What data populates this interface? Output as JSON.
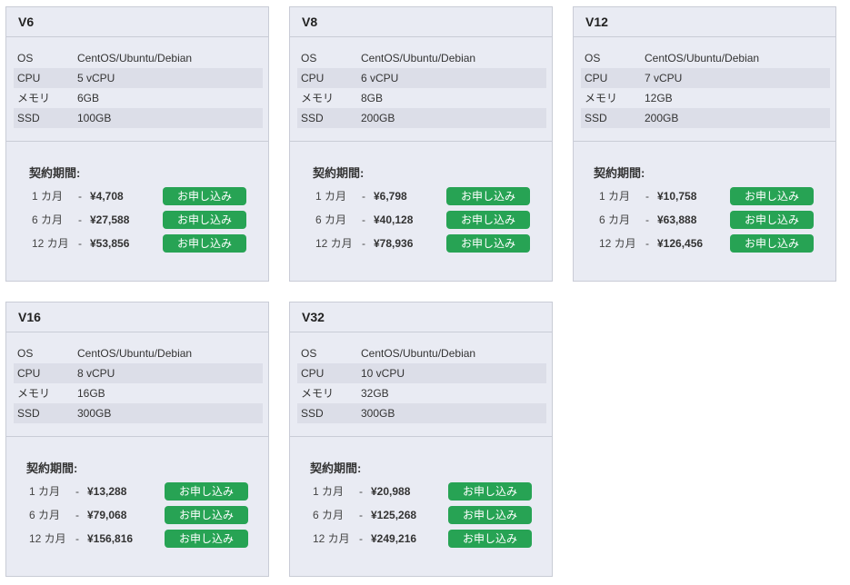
{
  "labels": {
    "os": "OS",
    "cpu": "CPU",
    "memory": "メモリ",
    "ssd": "SSD",
    "period_title": "契約期間:",
    "dash": "-",
    "apply": "お申し込み",
    "terms": [
      "1 カ月",
      "6 カ月",
      "12 カ月"
    ]
  },
  "plans": [
    {
      "name": "V6",
      "os": "CentOS/Ubuntu/Debian",
      "cpu": "5 vCPU",
      "memory": "6GB",
      "ssd": "100GB",
      "prices": [
        "¥4,708",
        "¥27,588",
        "¥53,856"
      ]
    },
    {
      "name": "V8",
      "os": "CentOS/Ubuntu/Debian",
      "cpu": "6 vCPU",
      "memory": "8GB",
      "ssd": "200GB",
      "prices": [
        "¥6,798",
        "¥40,128",
        "¥78,936"
      ]
    },
    {
      "name": "V12",
      "os": "CentOS/Ubuntu/Debian",
      "cpu": "7 vCPU",
      "memory": "12GB",
      "ssd": "200GB",
      "prices": [
        "¥10,758",
        "¥63,888",
        "¥126,456"
      ]
    },
    {
      "name": "V16",
      "os": "CentOS/Ubuntu/Debian",
      "cpu": "8 vCPU",
      "memory": "16GB",
      "ssd": "300GB",
      "prices": [
        "¥13,288",
        "¥79,068",
        "¥156,816"
      ]
    },
    {
      "name": "V32",
      "os": "CentOS/Ubuntu/Debian",
      "cpu": "10 vCPU",
      "memory": "32GB",
      "ssd": "300GB",
      "prices": [
        "¥20,988",
        "¥125,268",
        "¥249,216"
      ]
    }
  ],
  "colors": {
    "card_bg": "#e9ebf3",
    "row_shade": "#dcdee8",
    "button": "#27a354",
    "border": "#c9ccd6"
  }
}
